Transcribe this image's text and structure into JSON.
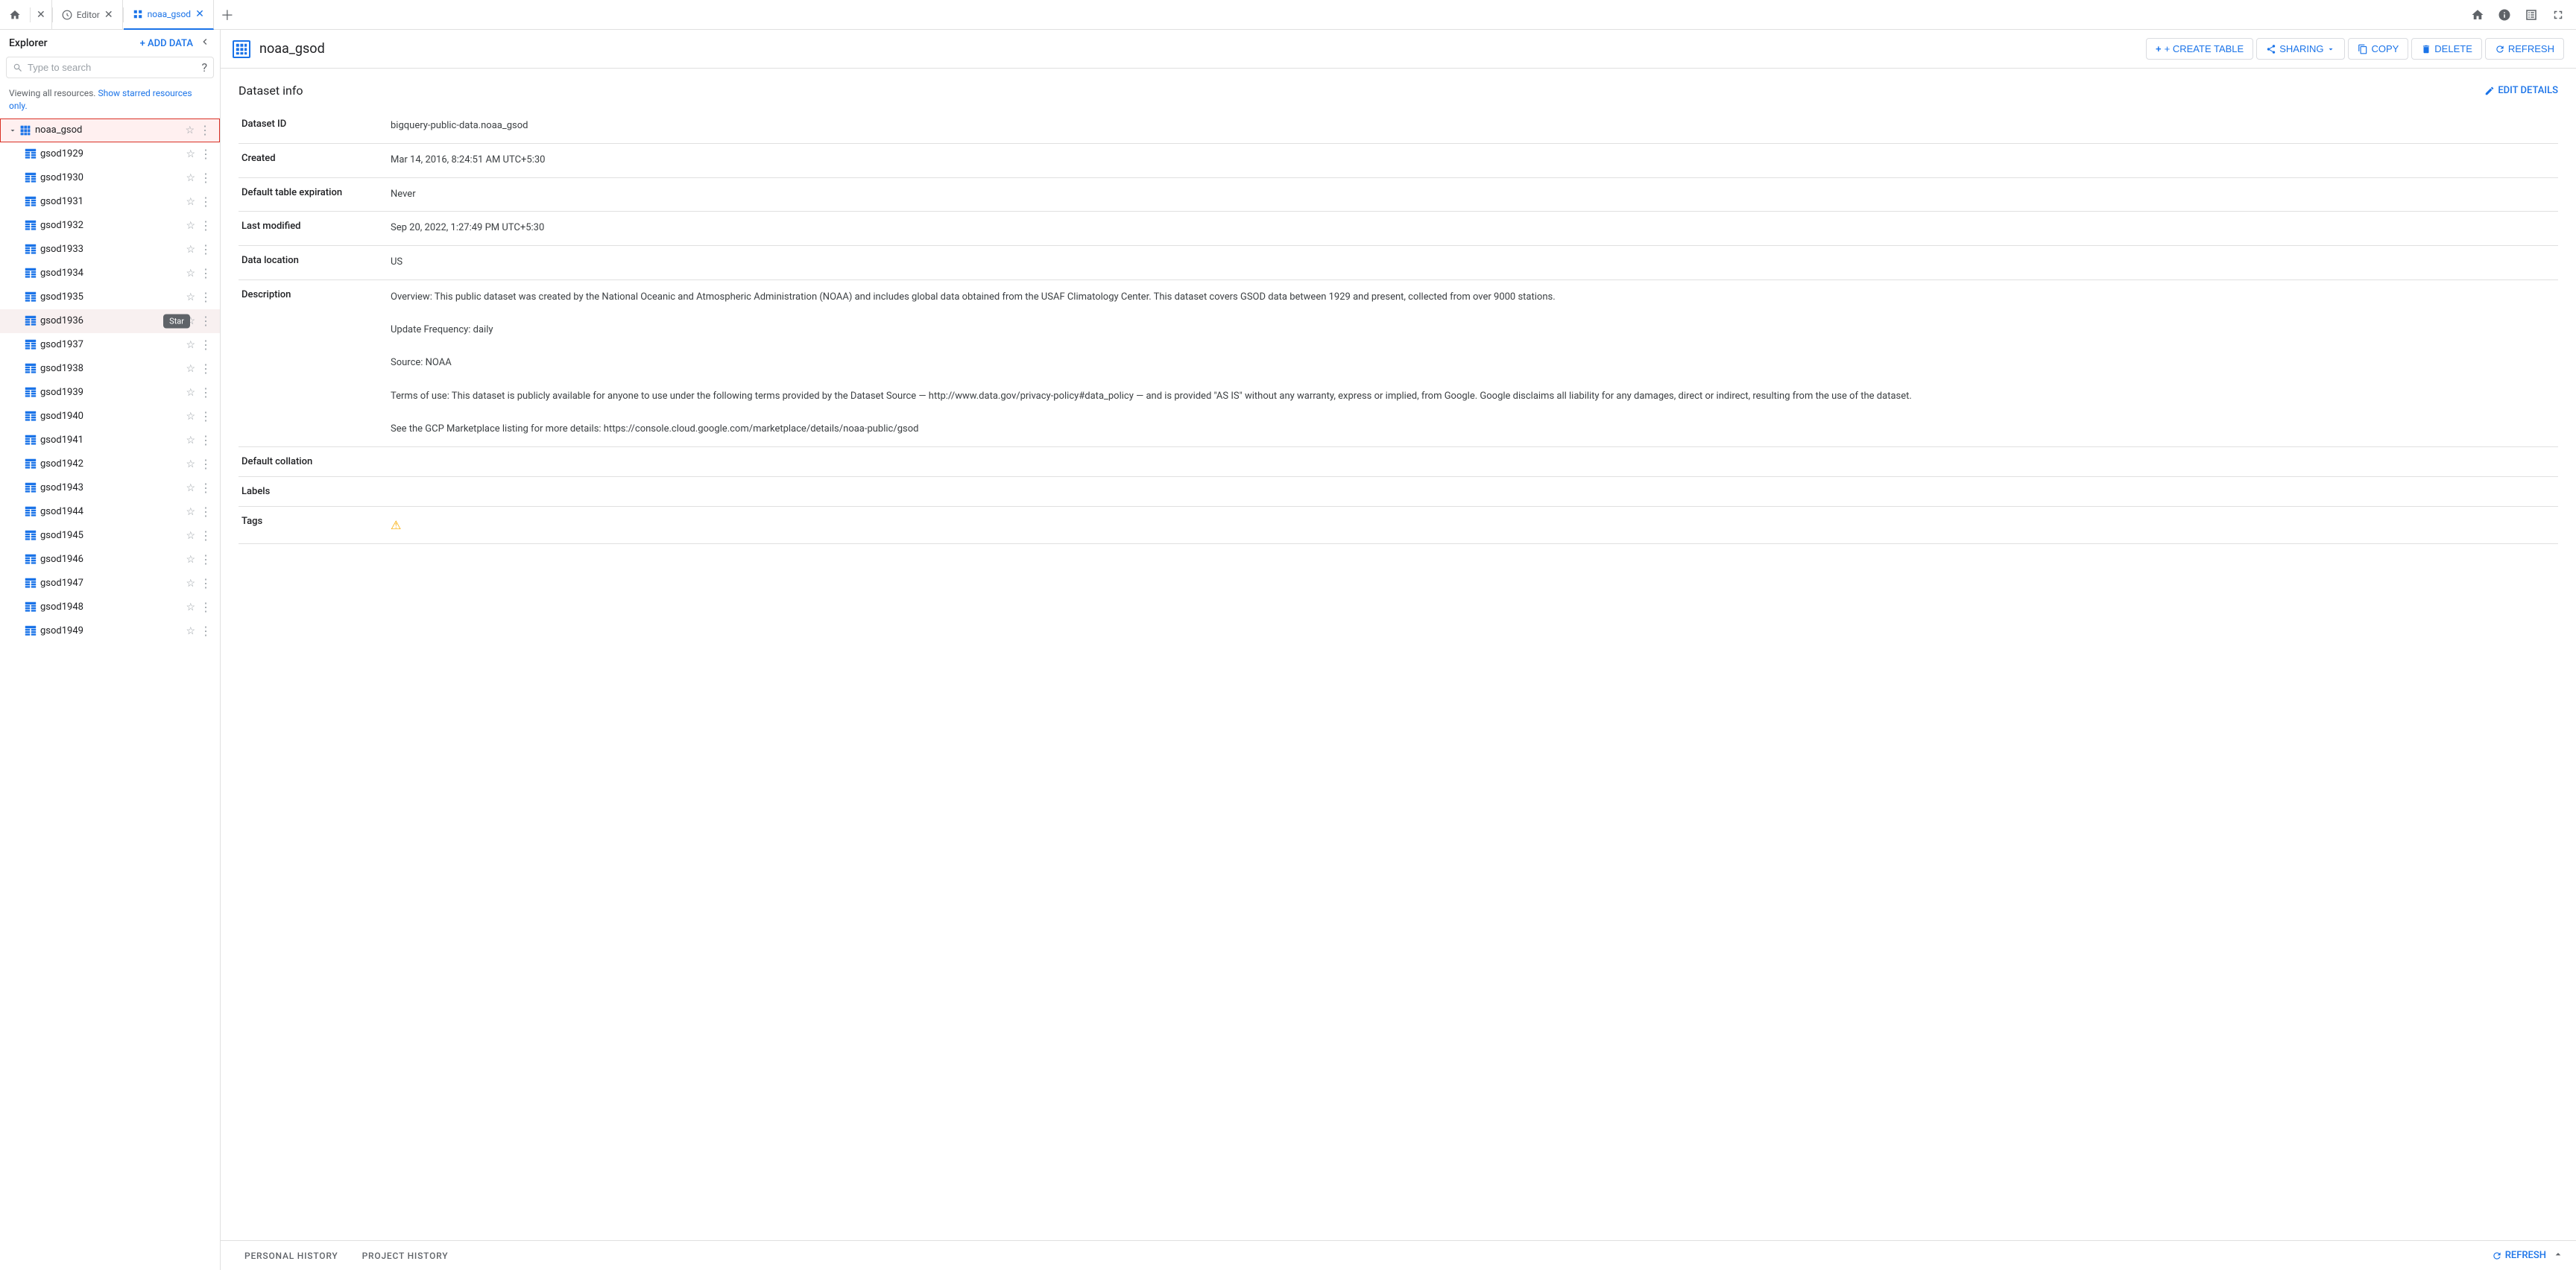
{
  "app": {
    "title": "Explorer"
  },
  "topNav": {
    "tabs": [
      {
        "id": "home",
        "label": "",
        "type": "home",
        "closeable": true,
        "active": false
      },
      {
        "id": "editor",
        "label": "Editor",
        "type": "editor",
        "closeable": true,
        "active": false
      },
      {
        "id": "noaa_gsod",
        "label": "noaa_gsod",
        "type": "dataset",
        "closeable": true,
        "active": true
      }
    ],
    "icons": [
      "home",
      "info",
      "table",
      "fullscreen"
    ]
  },
  "sidebar": {
    "title": "Explorer",
    "addDataLabel": "+ ADD DATA",
    "searchPlaceholder": "Type to search",
    "viewingText": "Viewing all resources.",
    "showStarredText": "Show starred resources only.",
    "rootNode": {
      "label": "noaa_gsod",
      "expanded": true
    },
    "items": [
      {
        "id": "gsod1929",
        "label": "gsod1929"
      },
      {
        "id": "gsod1930",
        "label": "gsod1930"
      },
      {
        "id": "gsod1931",
        "label": "gsod1931"
      },
      {
        "id": "gsod1932",
        "label": "gsod1932"
      },
      {
        "id": "gsod1933",
        "label": "gsod1933"
      },
      {
        "id": "gsod1934",
        "label": "gsod1934"
      },
      {
        "id": "gsod1935",
        "label": "gsod1935"
      },
      {
        "id": "gsod1936",
        "label": "gsod1936",
        "highlighted": true
      },
      {
        "id": "gsod1937",
        "label": "gsod1937"
      },
      {
        "id": "gsod1938",
        "label": "gsod1938"
      },
      {
        "id": "gsod1939",
        "label": "gsod1939"
      },
      {
        "id": "gsod1940",
        "label": "gsod1940"
      },
      {
        "id": "gsod1941",
        "label": "gsod1941"
      },
      {
        "id": "gsod1942",
        "label": "gsod1942"
      },
      {
        "id": "gsod1943",
        "label": "gsod1943"
      },
      {
        "id": "gsod1944",
        "label": "gsod1944"
      },
      {
        "id": "gsod1945",
        "label": "gsod1945"
      },
      {
        "id": "gsod1946",
        "label": "gsod1946"
      },
      {
        "id": "gsod1947",
        "label": "gsod1947"
      },
      {
        "id": "gsod1948",
        "label": "gsod1948"
      },
      {
        "id": "gsod1949",
        "label": "gsod1949"
      }
    ],
    "tooltipText": "Star"
  },
  "content": {
    "datasetName": "noaa_gsod",
    "actions": {
      "createTable": "+ CREATE TABLE",
      "sharing": "SHARING",
      "copy": "COPY",
      "delete": "DELETE",
      "refresh": "REFRESH"
    },
    "sectionTitle": "Dataset info",
    "editDetailsLabel": "EDIT DETAILS",
    "fields": {
      "datasetId": {
        "label": "Dataset ID",
        "value": "bigquery-public-data.noaa_gsod"
      },
      "created": {
        "label": "Created",
        "value": "Mar 14, 2016, 8:24:51 AM UTC+5:30"
      },
      "defaultTableExpiration": {
        "label": "Default table expiration",
        "value": "Never"
      },
      "lastModified": {
        "label": "Last modified",
        "value": "Sep 20, 2022, 1:27:49 PM UTC+5:30"
      },
      "dataLocation": {
        "label": "Data location",
        "value": "US"
      },
      "description": {
        "label": "Description",
        "value": "Overview: This public dataset was created by the National Oceanic and Atmospheric Administration (NOAA) and includes global data obtained from the USAF Climatology Center.  This dataset covers GSOD data between 1929 and present, collected from over 9000 stations.\n\nUpdate Frequency: daily\n\nSource: NOAA\n\nTerms of use: This dataset is publicly available for anyone to use under the following terms provided by the Dataset Source — http://www.data.gov/privacy-policy#data_policy — and is provided \"AS IS\" without any warranty, express or implied, from Google. Google disclaims all liability for any damages, direct or indirect, resulting from the use of the dataset.\n\nSee the GCP Marketplace listing for more details: https://console.cloud.google.com/marketplace/details/noaa-public/gsod"
      },
      "defaultCollation": {
        "label": "Default collation",
        "value": ""
      },
      "labels": {
        "label": "Labels",
        "value": ""
      },
      "tags": {
        "label": "Tags",
        "value": ""
      }
    }
  },
  "historyBar": {
    "tabs": [
      {
        "label": "PERSONAL HISTORY"
      },
      {
        "label": "PROJECT HISTORY"
      }
    ],
    "refreshLabel": "REFRESH"
  }
}
